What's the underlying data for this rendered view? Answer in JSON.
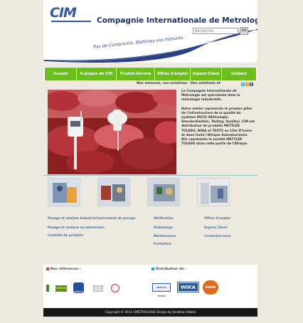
{
  "header": {
    "logo_text": "CIM",
    "company_name": "Compagnie Internationale de Metrologie",
    "slogan": "Pas de Compromis, Maîtrisez vos mesures",
    "search": {
      "placeholder": "Recherche",
      "button": "OK"
    }
  },
  "nav": {
    "items": [
      {
        "label": "Accueil"
      },
      {
        "label": "A propos de CIM"
      },
      {
        "label": "Produit-Service"
      },
      {
        "label": "Offres d'emploi"
      },
      {
        "label": "Espace Client"
      },
      {
        "label": "Contact"
      }
    ]
  },
  "ticker": {
    "text": "Nos mesures, vos solutions - Des solutions et"
  },
  "social": {
    "twitter": "t",
    "rss": "r",
    "facebook": "f"
  },
  "intro": {
    "p1": "La Compagnie Internationale de Métrologie est spécialisée dans le métrologie industrielle.",
    "p2": "Notre métier représente le premier pilier de l'infrastructure de la qualité du système MSTQ (Métrologie, Standardisation, Testing, Quality). CIM est distributeur de produits METTLER TOLEDO, WIKA et TESTO en Côte D'Ivoire et dans toute l'Afrique Subsaharienne. Elle représente la société METTLER TOLEDO dans cette partie de l'Afrique."
  },
  "links": {
    "col1": [
      "Pesage et analyse Industriel",
      "Pesage et analyse au laboratoire",
      "Contrôle de produits"
    ],
    "col2": [
      "Instrument de pesage"
    ],
    "col3": [
      "Vérification",
      "Etalonnage",
      "Maintenance",
      "Formation"
    ],
    "col4": [
      "Offres d'emploi",
      "Espace Client",
      "Contactez-nous"
    ]
  },
  "partners": {
    "references_title": "Nos références :",
    "distributor_title": "Distributeur de :",
    "references": [
      "CARGILL",
      "Unilever",
      "",
      ""
    ],
    "brands": [
      "METTLER TOLEDO",
      "WIKA",
      "testo"
    ]
  },
  "footer": {
    "text": "Copyright © 2014 CIMETROLOGIE Design by Jonathan Kabbe"
  },
  "colors": {
    "nav_green": "#6cbe1a",
    "brand_blue": "#2f55b0",
    "background": "#ede9de",
    "footer": "#181818"
  }
}
